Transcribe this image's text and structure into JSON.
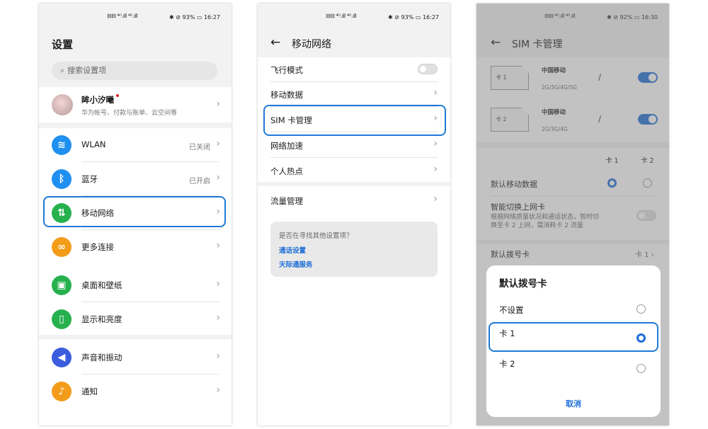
{
  "status_bar": [
    {
      "sim": "⊟⊟ ⁴ᴳ.ıll ⁴ᴳ.ıll",
      "icons": "✱ ⊘ 93% ▭",
      "time": "16:27"
    },
    {
      "sim": "⊟⊟ ⁴ᴳ.ıll ⁴ᴳ.ıll",
      "icons": "✱ ⊘ 93% ▭",
      "time": "16:27"
    },
    {
      "sim": "⊟⊟ ⁴ᴳ.ıll ⁴ᴳ.ıll",
      "icons": "✱ ⊘ 92% ▭",
      "time": "16:30"
    }
  ],
  "settings": {
    "title": "设置",
    "search_placeholder": "搜索设置项",
    "account": {
      "name": "眸小汐曦",
      "subtitle": "华为帐号、付款与账单、云空间等"
    },
    "items": [
      {
        "label": "WLAN",
        "value": "已关闭",
        "icon": "wifi-icon",
        "color": "#1f8ff0",
        "glyph": "≋"
      },
      {
        "label": "蓝牙",
        "value": "已开启",
        "icon": "bluetooth-icon",
        "color": "#1f8ff0",
        "glyph": "ᛒ"
      },
      {
        "label": "移动网络",
        "value": "",
        "icon": "mobile-network-icon",
        "color": "#27b14e",
        "glyph": "⇅"
      },
      {
        "label": "更多连接",
        "value": "",
        "icon": "more-connections-icon",
        "color": "#f39c1a",
        "glyph": "∞"
      },
      {
        "label": "桌面和壁纸",
        "value": "",
        "icon": "wallpaper-icon",
        "color": "#27b14e",
        "glyph": "▣"
      },
      {
        "label": "显示和亮度",
        "value": "",
        "icon": "display-icon",
        "color": "#27b14e",
        "glyph": "▯"
      },
      {
        "label": "声音和振动",
        "value": "",
        "icon": "sound-icon",
        "color": "#3b5ddd",
        "glyph": "◀"
      },
      {
        "label": "通知",
        "value": "",
        "icon": "notification-icon",
        "color": "#f39c1a",
        "glyph": "♪"
      }
    ]
  },
  "mobile_network": {
    "title": "移动网络",
    "items": [
      "飞行模式",
      "移动数据",
      "SIM 卡管理",
      "网络加速",
      "个人热点",
      "流量管理"
    ],
    "suggest_title": "是否在寻找其他设置项？",
    "suggest_links": [
      "通话设置",
      "天际通服务"
    ]
  },
  "sim_management": {
    "title": "SIM 卡管理",
    "cards": [
      {
        "label": "卡 1",
        "carrier": "中国移动",
        "bands": "2G/3G/4G/5G"
      },
      {
        "label": "卡 2",
        "carrier": "中国移动",
        "bands": "2G/3G/4G"
      }
    ],
    "col1": "卡 1",
    "col2": "卡 2",
    "default_data": "默认移动数据",
    "smart_switch": "智能切换上网卡",
    "smart_switch_desc1": "根据网络质量状况和通话状态，暂时切",
    "smart_switch_desc2": "换至卡 2 上网，需消耗卡 2 流量",
    "default_dial": "默认拨号卡",
    "default_dial_value": "卡 1"
  },
  "dialog": {
    "title": "默认拨号卡",
    "options": [
      "不设置",
      "卡 1",
      "卡 2"
    ],
    "selected": 1,
    "cancel": "取消"
  },
  "accent": "#1e7ad8"
}
